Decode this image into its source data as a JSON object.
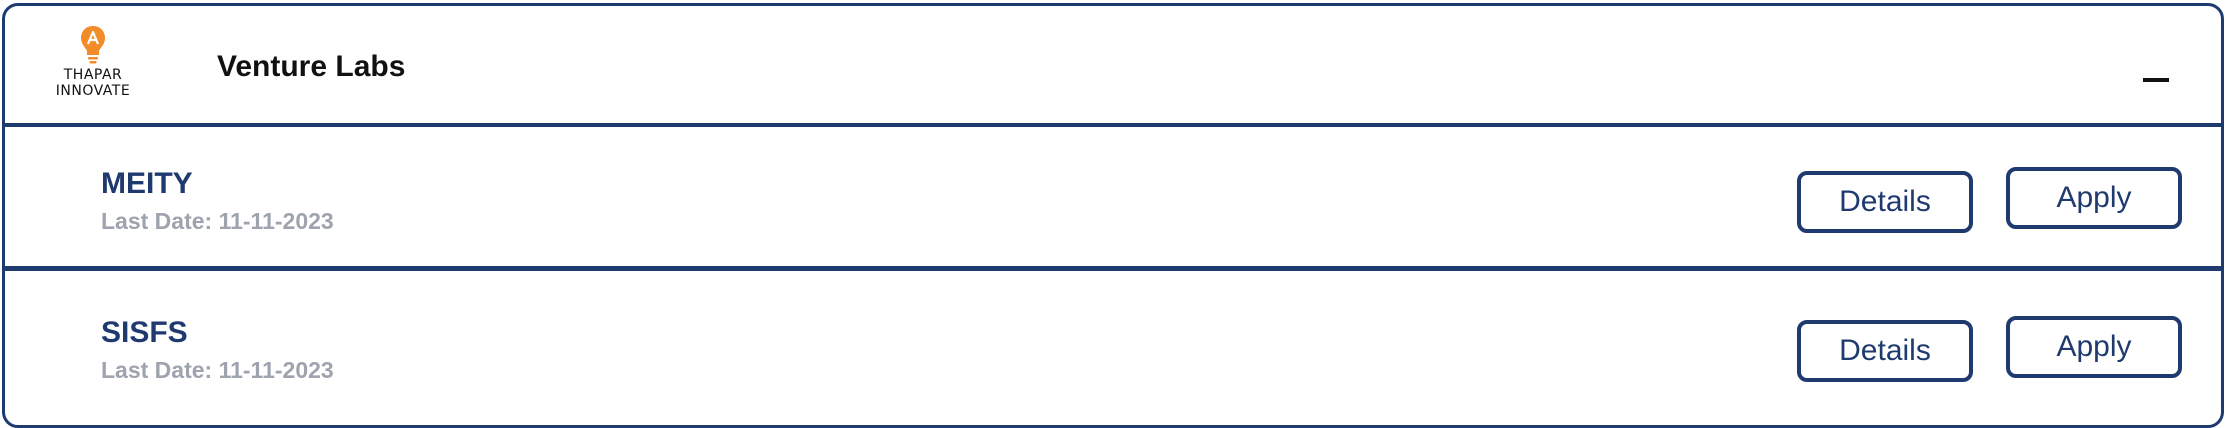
{
  "header": {
    "logo_line1": "THAPAR",
    "logo_line2": "INNOVATE",
    "title": "Venture Labs",
    "collapse_icon": "minus-icon"
  },
  "schemes": [
    {
      "name": "MEITY",
      "last_date": "Last Date: 11-11-2023",
      "details_label": "Details",
      "apply_label": "Apply"
    },
    {
      "name": "SISFS",
      "last_date": "Last Date: 11-11-2023",
      "details_label": "Details",
      "apply_label": "Apply"
    }
  ],
  "colors": {
    "primary": "#1f3a6e",
    "muted_text": "#9ea3ad",
    "logo_accent": "#f28c28"
  }
}
